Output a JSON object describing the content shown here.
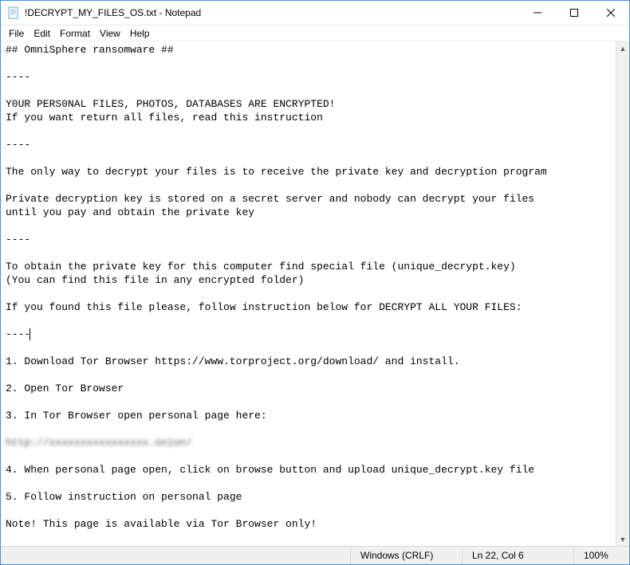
{
  "titlebar": {
    "title": "!DECRYPT_MY_FILES_OS.txt - Notepad"
  },
  "menu": {
    "file": "File",
    "edit": "Edit",
    "format": "Format",
    "view": "View",
    "help": "Help"
  },
  "document": {
    "lines": [
      "## OmniSphere ransomware ##",
      "",
      "----",
      "",
      "Y0UR PERS0NAL FILES, PHOTOS, DATABASES ARE ENCRYPTED!",
      "If you want return all files, read this instruction",
      "",
      "----",
      "",
      "The only way to decrypt your files is to receive the private key and decryption program",
      "",
      "Private decryption key is stored on a secret server and nobody can decrypt your files",
      "until you pay and obtain the private key",
      "",
      "----",
      "",
      "To obtain the private key for this computer find special file (unique_decrypt.key)",
      "(You can find this file in any encrypted folder)",
      "",
      "If you found this file please, follow instruction below for DECRYPT ALL YOUR FILES:",
      "",
      "----",
      "",
      "1. Download Tor Browser https://www.torproject.org/download/ and install.",
      "",
      "2. Open Tor Browser",
      "",
      "3. In Tor Browser open personal page here:",
      "",
      "http://xxxxxxxxxxxxxxxx.onion/",
      "",
      "4. When personal page open, click on browse button and upload unique_decrypt.key file",
      "",
      "5. Follow instruction on personal page",
      "",
      "Note! This page is available via Tor Browser only!"
    ],
    "obscured_line_index": 29,
    "caret_line_index": 21
  },
  "status": {
    "encoding": "Windows (CRLF)",
    "position": "Ln 22, Col 6",
    "zoom": "100%"
  }
}
